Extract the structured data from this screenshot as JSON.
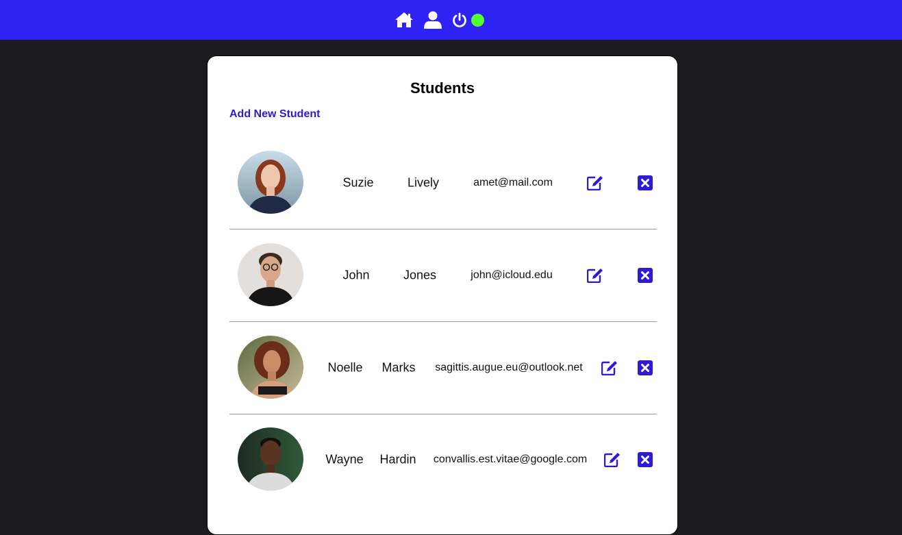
{
  "nav": {
    "icons": [
      "home-icon",
      "user-icon",
      "power-icon"
    ],
    "status_color": "#55ff2e",
    "accent": "#2f22f5"
  },
  "page": {
    "title": "Students",
    "add_link": "Add New Student"
  },
  "students": [
    {
      "first": "Suzie",
      "last": "Lively",
      "email": "amet@mail.com",
      "avatar": "woman-red-hair"
    },
    {
      "first": "John",
      "last": "Jones",
      "email": "john@icloud.edu",
      "avatar": "man-glasses"
    },
    {
      "first": "Noelle",
      "last": "Marks",
      "email": "sagittis.augue.eu@outlook.net",
      "avatar": "woman-curly-hair"
    },
    {
      "first": "Wayne",
      "last": "Hardin",
      "email": "convallis.est.vitae@google.com",
      "avatar": "man-short-hair"
    }
  ],
  "row_actions": {
    "edit": "edit-icon",
    "delete": "delete-icon"
  }
}
